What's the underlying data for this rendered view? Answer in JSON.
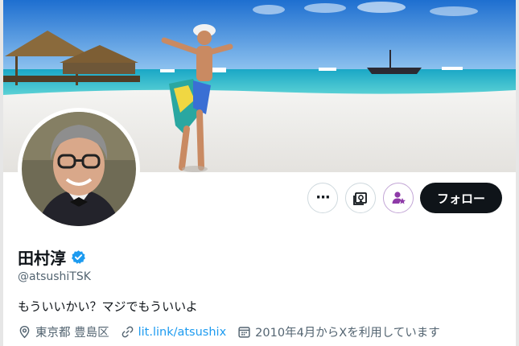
{
  "profile": {
    "name": "田村淳",
    "handle": "@atsushiTSK",
    "bio": "もういいかい？マジでもういいよ",
    "location": "東京都 豊島区",
    "link": "lit.link/atsushix",
    "joined": "2010年4月からXを利用しています"
  },
  "actions": {
    "more_label": "···",
    "follow_label": "フォロー"
  },
  "icons": {
    "more": "more-icon",
    "monetize": "image-card-icon",
    "subscribe": "person-star-icon",
    "verified": "verified-badge-icon",
    "location": "location-pin-icon",
    "link": "link-icon",
    "calendar": "calendar-icon"
  },
  "colors": {
    "follow_bg": "#0f1419",
    "verified": "#1d9bf0",
    "link": "#1d9bf0",
    "subscribe_accent": "#8e3aa8",
    "muted": "#536471"
  }
}
